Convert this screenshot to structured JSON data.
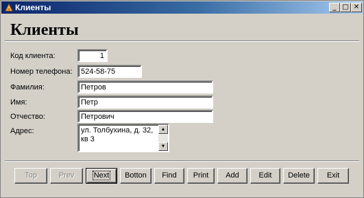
{
  "window": {
    "title": "Клиенты",
    "minimize": "_",
    "maximize": "□",
    "close": "✕"
  },
  "form": {
    "heading": "Клиенты",
    "fields": [
      {
        "label": "Код клиента:",
        "value": "1"
      },
      {
        "label": "Номер телефона:",
        "value": "524-58-75"
      },
      {
        "label": "Фамилия:",
        "value": "Петров"
      },
      {
        "label": "Имя:",
        "value": "Петр"
      },
      {
        "label": "Отчество:",
        "value": "Петрович"
      }
    ],
    "address": {
      "label": "Адрес:",
      "value": "ул. Толбухина, д. 32, кв 3"
    }
  },
  "buttons": [
    {
      "label": "Top",
      "enabled": false
    },
    {
      "label": "Prev",
      "enabled": false
    },
    {
      "label": "Next",
      "enabled": true
    },
    {
      "label": "Botton",
      "enabled": true
    },
    {
      "label": "Find",
      "enabled": true
    },
    {
      "label": "Print",
      "enabled": true
    },
    {
      "label": "Add",
      "enabled": true
    },
    {
      "label": "Edit",
      "enabled": true
    },
    {
      "label": "Delete",
      "enabled": true
    },
    {
      "label": "Exit",
      "enabled": true
    }
  ]
}
